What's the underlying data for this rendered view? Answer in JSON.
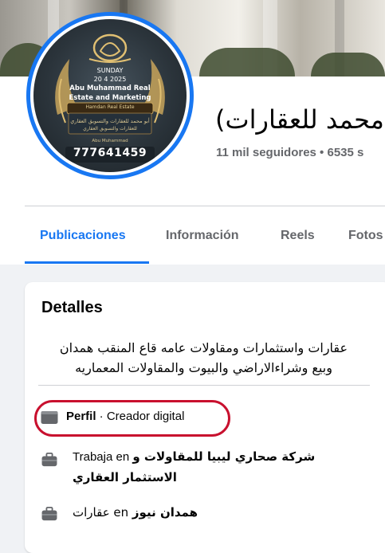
{
  "avatar": {
    "day": "SUNDAY",
    "date": "20 4 2025",
    "company_line1": "Abu Muhammad Real",
    "company_line2": "Estate and Marketing",
    "subtitle": "Hamdan Real Estate",
    "arabic_line1": "أبو محمد للعقارات والتسويق العقاري",
    "arabic_line2": "للعقارات والتسويق العقاري",
    "owner": "Abu Muhammad",
    "phone": "777641459"
  },
  "page": {
    "name": "محمد للعقارات)",
    "stats": "11 mil seguidores • 6535 s"
  },
  "tabs": [
    {
      "label": "Publicaciones",
      "active": true
    },
    {
      "label": "Información",
      "active": false
    },
    {
      "label": "Reels",
      "active": false
    },
    {
      "label": "Fotos",
      "active": false
    }
  ],
  "details": {
    "title": "Detalles",
    "bio_line1": "عقارات واستثمارات ومقاولات عامه قاع المنقب همدان",
    "bio_line2": "وبيع وشراءالاراضي والبيوت والمقاولات المعماريه",
    "profile": {
      "label_bold": "Perfil",
      "label_rest": " · Creador digital",
      "icon": "profile-card-icon"
    },
    "work1": {
      "prefix": "Trabaja en ",
      "company_part1": "شركة صحاري ليبيا للمقاولات و",
      "company_part2": "الاستثمار العقاري",
      "icon": "briefcase-icon"
    },
    "work2": {
      "prefix": "عقارات en ",
      "company": "همدان نيوز",
      "icon": "briefcase-icon"
    }
  },
  "colors": {
    "accent": "#1877f2",
    "highlight": "#c8102e",
    "muted": "#65676b",
    "background": "#f0f2f5"
  }
}
